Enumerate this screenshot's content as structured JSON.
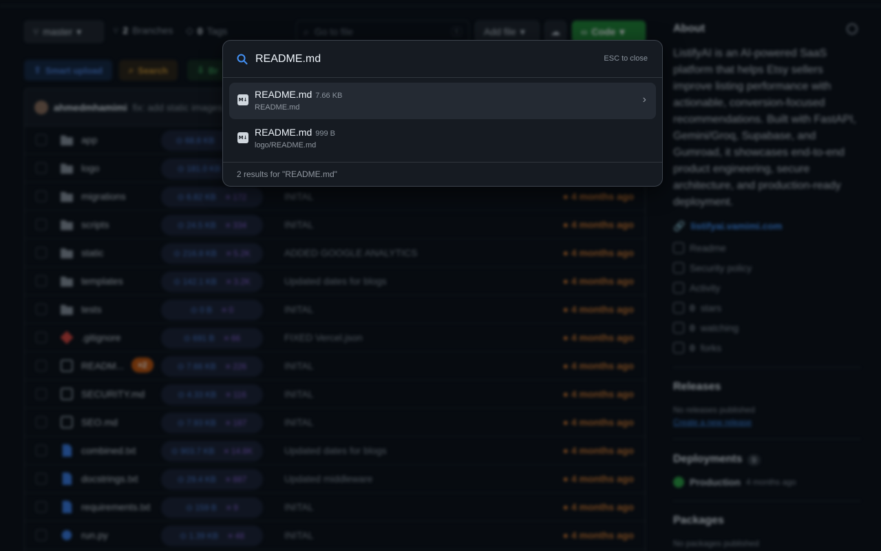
{
  "repo": {
    "branch": "master",
    "branches": {
      "count": "2",
      "label": "Branches"
    },
    "tags": {
      "count": "0",
      "label": "Tags"
    },
    "goto_placeholder": "Go to file",
    "goto_shortcut": "t",
    "add_file": "Add file",
    "code": "Code",
    "actions": {
      "smart_upload": "Smart upload",
      "search": "Search",
      "third": "Br"
    },
    "commit": {
      "author": "ahmedmhamimi",
      "message": "fix: add static images"
    },
    "files": [
      {
        "type": "folder",
        "name": "app",
        "size": "68.8 KB",
        "lines": "1.7K",
        "msg": "",
        "age": "4 months ago"
      },
      {
        "type": "folder",
        "name": "logo",
        "size": "181.0 KB",
        "lines": "13",
        "msg": "",
        "age": "4 months ago"
      },
      {
        "type": "folder",
        "name": "migrations",
        "size": "6.82 KB",
        "lines": "172",
        "msg": "INITAL",
        "age": "4 months ago"
      },
      {
        "type": "folder",
        "name": "scripts",
        "size": "24.5 KB",
        "lines": "334",
        "msg": "INITAL",
        "age": "4 months ago"
      },
      {
        "type": "folder",
        "name": "static",
        "size": "216.8 KB",
        "lines": "5.2K",
        "msg": "ADDED GOOGLE ANALYTICS",
        "age": "4 months ago"
      },
      {
        "type": "folder",
        "name": "templates",
        "size": "142.1 KB",
        "lines": "3.2K",
        "msg": "Updated dates for blogs",
        "age": "4 months ago"
      },
      {
        "type": "folder",
        "name": "tests",
        "size": "0 B",
        "lines": "0",
        "msg": "INITAL",
        "age": "4 months ago"
      },
      {
        "type": "git",
        "name": ".gitignore",
        "size": "691 B",
        "lines": "66",
        "msg": "FIXED Vercel.json",
        "age": "4 months ago"
      },
      {
        "type": "md",
        "name": "READM...",
        "size": "7.66 KB",
        "lines": "226",
        "msg": "INITAL",
        "age": "4 months ago",
        "badge": "×2"
      },
      {
        "type": "md",
        "name": "SECURITY.md",
        "size": "4.33 KB",
        "lines": "116",
        "msg": "INITAL",
        "age": "4 months ago"
      },
      {
        "type": "md",
        "name": "SEO.md",
        "size": "7.93 KB",
        "lines": "187",
        "msg": "INITAL",
        "age": "4 months ago"
      },
      {
        "type": "txt",
        "name": "combined.txt",
        "size": "903.7 KB",
        "lines": "14.8K",
        "msg": "Updated dates for blogs",
        "age": "4 months ago"
      },
      {
        "type": "txt",
        "name": "docstrings.txt",
        "size": "29.4 KB",
        "lines": "887",
        "msg": "Updated middleware",
        "age": "4 months ago"
      },
      {
        "type": "txt",
        "name": "requirements.txt",
        "size": "159 B",
        "lines": "9",
        "msg": "INITAL",
        "age": "4 months ago"
      },
      {
        "type": "py",
        "name": "run.py",
        "size": "1.39 KB",
        "lines": "48",
        "msg": "INITAL",
        "age": "4 months ago"
      }
    ]
  },
  "sidebar": {
    "about_title": "About",
    "about_text": "ListifyAI is an AI-powered SaaS platform that helps Etsy sellers improve listing performance with actionable, conversion-focused recommendations. Built with FastAPI, Gemini/Groq, Supabase, and Gumroad, it showcases end-to-end product engineering, secure architecture, and production-ready deployment.",
    "website": "listifyai.vamimi.com",
    "items": [
      {
        "label": "Readme"
      },
      {
        "label": "Security policy"
      },
      {
        "label": "Activity"
      },
      {
        "count": "0",
        "label": "stars"
      },
      {
        "count": "0",
        "label": "watching"
      },
      {
        "count": "0",
        "label": "forks"
      }
    ],
    "releases": {
      "title": "Releases",
      "none": "No releases published",
      "create": "Create a new release"
    },
    "deployments": {
      "title": "Deployments",
      "count": "9",
      "env": "Production",
      "when": "4 months ago"
    },
    "packages": {
      "title": "Packages",
      "none": "No packages published"
    }
  },
  "search_modal": {
    "query": "README.md",
    "esc_hint": "ESC to close",
    "results": [
      {
        "name": "README.md",
        "size": "7.66 KB",
        "path": "README.md",
        "active": true
      },
      {
        "name": "README.md",
        "size": "999 B",
        "path": "logo/README.md",
        "active": false
      }
    ],
    "summary": "2 results for \"README.md\""
  },
  "colors": {
    "accent": "#4493f8",
    "code_button": "#238636",
    "age": "#d1792f",
    "badge": "#c2560d"
  }
}
